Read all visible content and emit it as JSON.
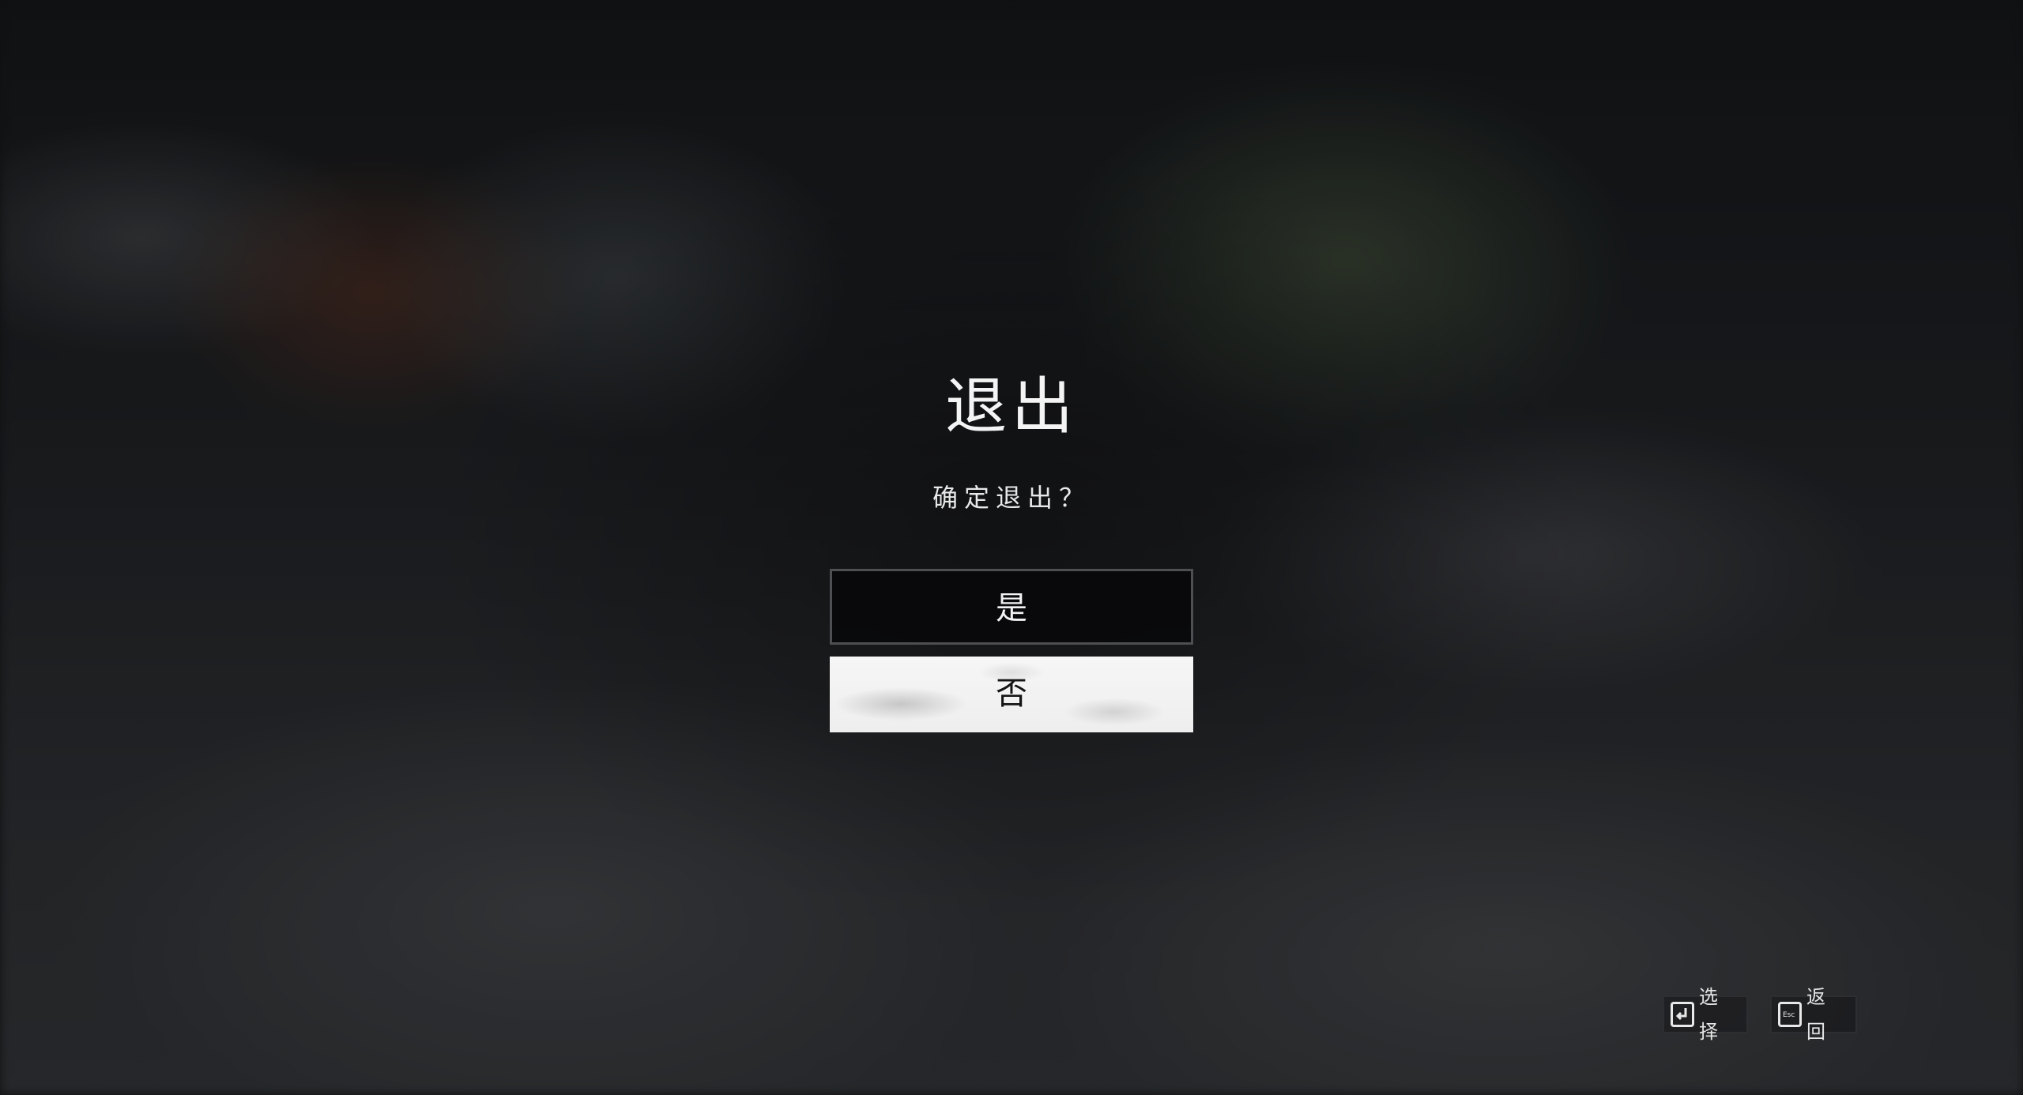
{
  "dialog": {
    "title": "退出",
    "message": "确定退出？",
    "yes_label": "是",
    "no_label": "否"
  },
  "hints": {
    "select_label": "选择",
    "back_label": "返回",
    "back_key_text": "Esc",
    "select_key_icon": "enter-key-icon",
    "back_key_icon": "esc-key-icon"
  }
}
